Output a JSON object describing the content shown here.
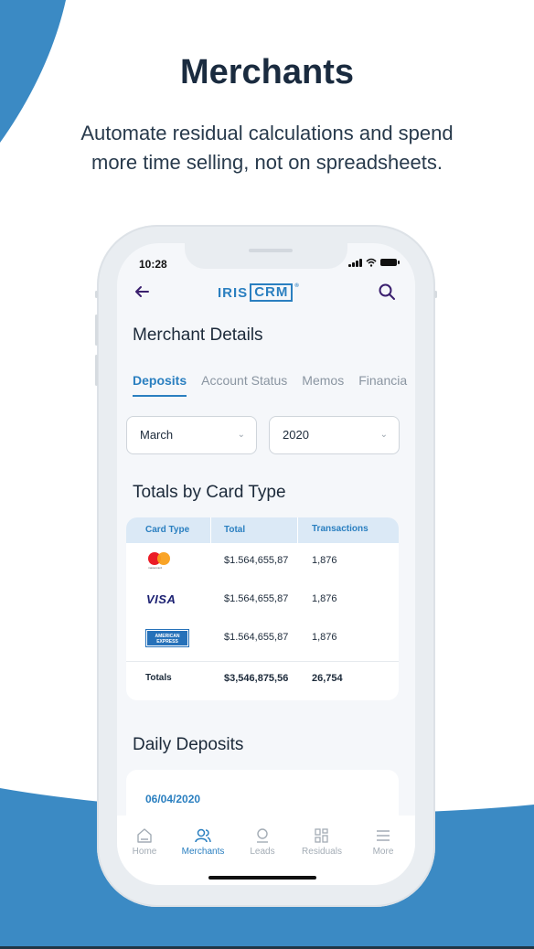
{
  "marketing": {
    "headline": "Merchants",
    "subline_1": "Automate residual calculations and spend",
    "subline_2": "more time selling, not on spreadsheets."
  },
  "colors": {
    "accent": "#2a7fc0",
    "brand_wave": "#3b8ac4",
    "text_dark": "#1a2b3f"
  },
  "status_bar": {
    "time": "10:28"
  },
  "app": {
    "logo_iris": "IRIS",
    "logo_crm": "CRM",
    "logo_mark": "®",
    "back_icon": "arrow-left-icon",
    "search_icon": "search-icon"
  },
  "page": {
    "title": "Merchant Details",
    "tabs": [
      {
        "label": "Deposits",
        "active": true
      },
      {
        "label": "Account Status",
        "active": false
      },
      {
        "label": "Memos",
        "active": false
      },
      {
        "label": "Financia",
        "active": false
      }
    ]
  },
  "filters": {
    "month": "March",
    "year": "2020"
  },
  "totals_section": {
    "title": "Totals by Card Type",
    "columns": [
      "Card Type",
      "Total",
      "Transactions"
    ],
    "rows": [
      {
        "card": "mastercard",
        "card_caption": "mastercard",
        "total": "$1.564,655,87",
        "transactions": "1,876"
      },
      {
        "card": "visa",
        "card_caption": "VISA",
        "total": "$1.564,655,87",
        "transactions": "1,876"
      },
      {
        "card": "amex",
        "card_caption_1": "AMERICAN",
        "card_caption_2": "EXPRESS",
        "total": "$1.564,655,87",
        "transactions": "1,876"
      }
    ],
    "totals": {
      "label": "Totals",
      "total": "$3,546,875,56",
      "transactions": "26,754"
    }
  },
  "daily_section": {
    "title": "Daily Deposits",
    "first_date": "06/04/2020"
  },
  "bottom_nav": [
    {
      "label": "Home",
      "icon": "home-icon",
      "active": false
    },
    {
      "label": "Merchants",
      "icon": "users-icon",
      "active": true
    },
    {
      "label": "Leads",
      "icon": "user-icon",
      "active": false
    },
    {
      "label": "Residuals",
      "icon": "grid-icon",
      "active": false
    },
    {
      "label": "More",
      "icon": "menu-icon",
      "active": false
    }
  ]
}
